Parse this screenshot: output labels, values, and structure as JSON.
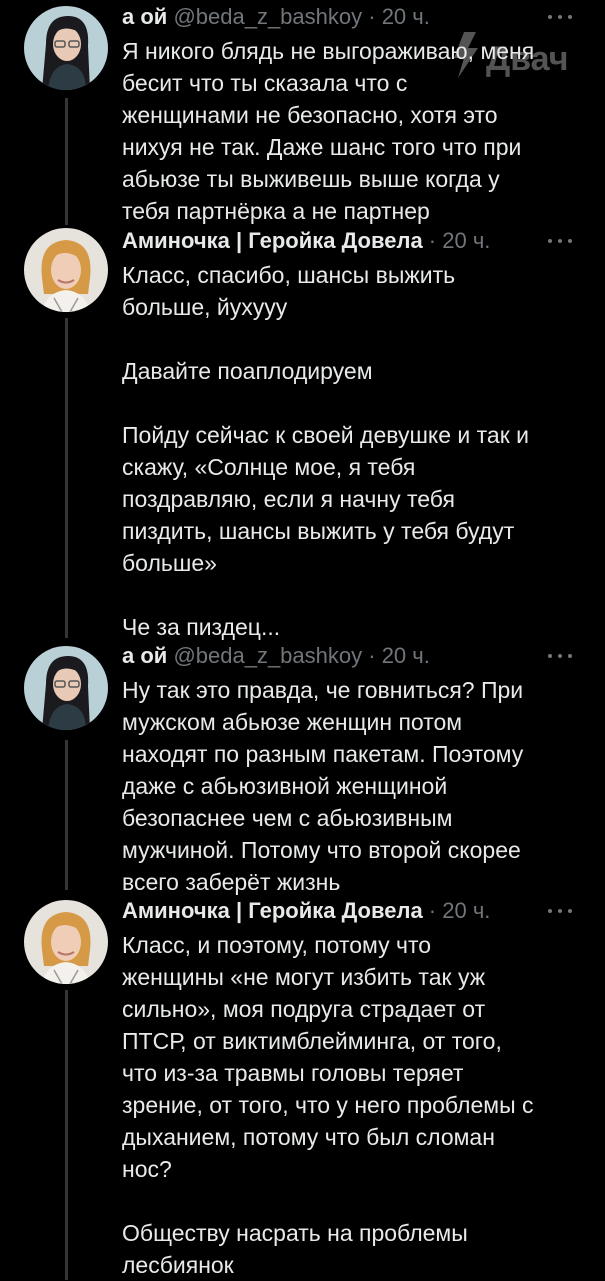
{
  "watermark": {
    "text": "Двач",
    "icon": "lightning-logo"
  },
  "thread": [
    {
      "author": "а ой",
      "handle": "@beda_z_bashkoy",
      "time": "20 ч.",
      "avatar": "anime-girl-avatar",
      "paragraphs": [
        "Я никого блядь не выгораживаю, меня\nбесит что ты сказала что с\nженщинами не безопасно, хотя это\nнихуя не так. Даже шанс того что при\nабьюзе ты выживешь выше когда у\nтебя партнёрка а не партнер"
      ]
    },
    {
      "author": "Аминочка | Геройка Довела",
      "time": "20 ч.",
      "avatar": "blonde-girl-avatar",
      "paragraphs": [
        "Класс, спасибо, шансы выжить\nбольше, йухууу",
        "Давайте поаплодируем",
        "Пойду сейчас к своей девушке и так и\nскажу, «Солнце мое, я тебя\nпоздравляю, если я начну тебя\nпиздить, шансы выжить у тебя будут\nбольше»",
        "Че за пиздец..."
      ]
    },
    {
      "author": "а ой",
      "handle": "@beda_z_bashkoy",
      "time": "20 ч.",
      "avatar": "anime-girl-avatar",
      "paragraphs": [
        "Ну так это правда, че говниться? При\nмужском абьюзе женщин потом\nнаходят по разным пакетам. Поэтому\nдаже с абьюзивной женщиной\nбезопаснее чем с абьюзивным\nмужчиной. Потому что второй скорее\nвсего заберёт жизнь"
      ]
    },
    {
      "author": "Аминочка | Геройка Довела",
      "time": "20 ч.",
      "avatar": "blonde-girl-avatar",
      "paragraphs": [
        "Класс, и поэтому, потому что\nженщины «не могут избить так уж\nсильно», моя подруга страдает от\nПТСР, от виктимблейминга, от того,\nчто из-за травмы головы теряет\nзрение, от того, что у него проблемы с\nдыханием, потому что был сломан\nнос?",
        "Обществу насрать на проблемы\nлесбиянок"
      ]
    }
  ],
  "colors": {
    "background": "#000000",
    "text": "#e7e9ea",
    "secondary": "#71767b",
    "thread_line": "#333639"
  }
}
